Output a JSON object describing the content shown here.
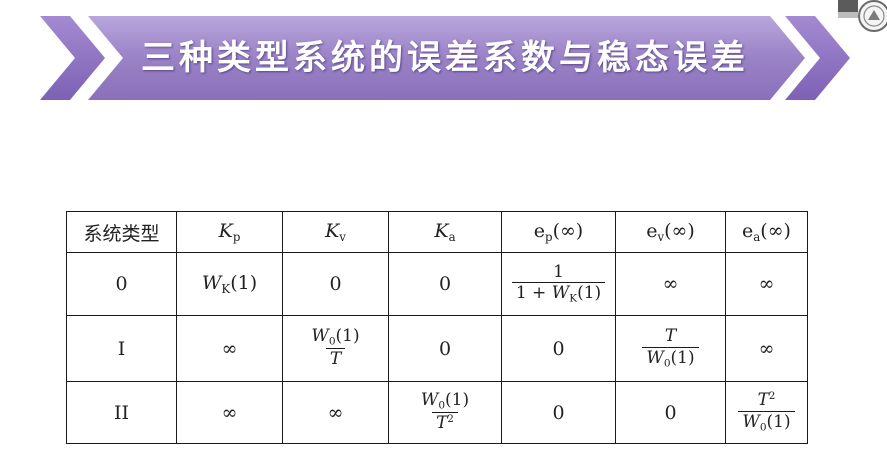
{
  "slide": {
    "title": "三种类型系统的误差系数与稳态误差",
    "colors": {
      "banner_main": "#9a82c6",
      "banner_chevron": "#8c6ec0",
      "border": "#1a1a1a"
    }
  },
  "table": {
    "headers": {
      "type": "系统类型",
      "kp_base": "K",
      "kp_sub": "p",
      "kv_base": "K",
      "kv_sub": "v",
      "ka_base": "K",
      "ka_sub": "a",
      "ep_base": "e",
      "ep_sub": "p",
      "ep_arg": "(∞)",
      "ev_base": "e",
      "ev_sub": "v",
      "ev_arg": "(∞)",
      "ea_base": "e",
      "ea_sub": "a",
      "ea_arg": "(∞)"
    },
    "rows": [
      {
        "type": "0",
        "kp_base": "W",
        "kp_sub": "K",
        "kp_arg": "(1)",
        "kv": "0",
        "ka": "0",
        "ep_num": "1",
        "ep_den_pre": "1 + ",
        "ep_den_base": "W",
        "ep_den_sub": "K",
        "ep_den_arg": "(1)",
        "ev": "∞",
        "ea": "∞"
      },
      {
        "type": "I",
        "kp": "∞",
        "kv_num_base": "W",
        "kv_num_sub": "0",
        "kv_num_arg": "(1)",
        "kv_den": "T",
        "ka": "0",
        "ep": "0",
        "ev_num": "T",
        "ev_den_base": "W",
        "ev_den_sub": "0",
        "ev_den_arg": "(1)",
        "ea": "∞"
      },
      {
        "type": "II",
        "kp": "∞",
        "kv": "∞",
        "ka_num_base": "W",
        "ka_num_sub": "0",
        "ka_num_arg": "(1)",
        "ka_den_base": "T",
        "ka_den_sup": "2",
        "ep": "0",
        "ev": "0",
        "ea_num_base": "T",
        "ea_num_sup": "2",
        "ea_den_base": "W",
        "ea_den_sub": "0",
        "ea_den_arg": "(1)"
      }
    ]
  }
}
